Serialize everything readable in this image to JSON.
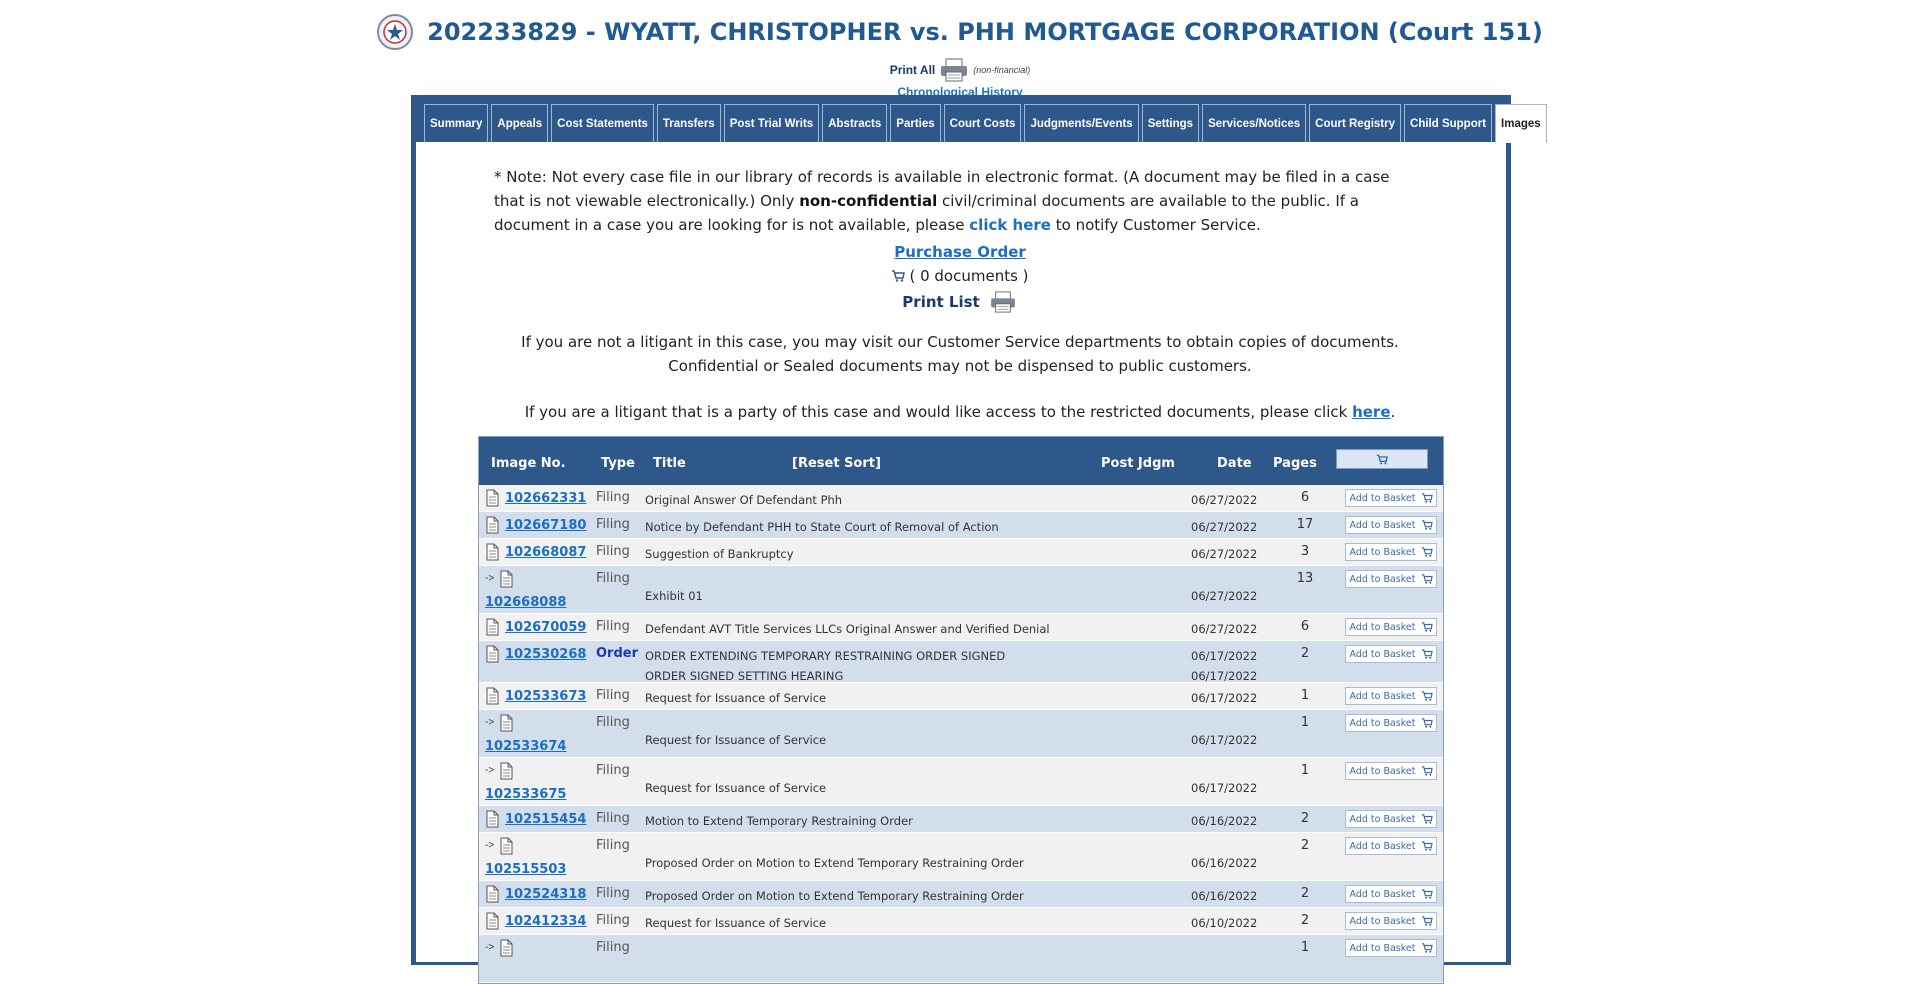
{
  "header": {
    "case_title": "202233829 - WYATT, CHRISTOPHER vs. PHH MORTGAGE CORPORATION (Court 151)",
    "print_all": "Print All",
    "non_financial": "(non-financial)",
    "chronological_history": "Chronological History"
  },
  "tabs": [
    {
      "label": "Summary"
    },
    {
      "label": "Appeals"
    },
    {
      "label": "Cost Statements"
    },
    {
      "label": "Transfers"
    },
    {
      "label": "Post Trial Writs"
    },
    {
      "label": "Abstracts"
    },
    {
      "label": "Parties"
    },
    {
      "label": "Court Costs"
    },
    {
      "label": "Judgments/Events"
    },
    {
      "label": "Settings"
    },
    {
      "label": "Services/Notices"
    },
    {
      "label": "Court Registry"
    },
    {
      "label": "Child Support"
    },
    {
      "label": "Images"
    }
  ],
  "notice": {
    "part1": "* Note: Not every case file in our library of records is available in electronic format. (A document may be filed in a case that is not viewable electronically.) Only ",
    "bold": "non-confidential",
    "part2": " civil/criminal documents are available to the public. If a document in a case you are looking for is not available, please ",
    "link": "click here",
    "part3": " to notify Customer Service."
  },
  "purchase_order": "Purchase Order",
  "documents_count": "( 0 documents )",
  "print_list": "Print List",
  "info_non_litigant": "If you are not a litigant in this case, you may visit our Customer Service departments to obtain copies of documents. Confidential or Sealed documents may not be dispensed to public customers.",
  "info_litigant": "If you are a litigant that is a party of this case and would like access to the restricted documents, please click ",
  "info_litigant_link": "here",
  "info_litigant_end": ".",
  "grid": {
    "headers": {
      "image_no": "Image No.",
      "type": "Type",
      "title": "Title",
      "reset_sort": "[Reset Sort]",
      "post_jdgm": "Post Jdgm",
      "date": "Date",
      "pages": "Pages",
      "add_entire_case": "Add Entire Case"
    },
    "add_to_basket": "Add to Basket",
    "rows": [
      {
        "image_no": "102662331",
        "type": "Filing",
        "title": "Original Answer Of Defendant Phh",
        "title2": "",
        "date": "06/27/2022",
        "date2": "",
        "pages": "6",
        "child": false
      },
      {
        "image_no": "102667180",
        "type": "Filing",
        "title": "Notice by Defendant PHH to State Court of Removal of Action",
        "title2": "",
        "date": "06/27/2022",
        "date2": "",
        "pages": "17",
        "child": false
      },
      {
        "image_no": "102668087",
        "type": "Filing",
        "title": "Suggestion of Bankruptcy",
        "title2": "",
        "date": "06/27/2022",
        "date2": "",
        "pages": "3",
        "child": false
      },
      {
        "image_no": "102668088",
        "type": "Filing",
        "title": "Exhibit 01",
        "title2": "",
        "date": "06/27/2022",
        "date2": "",
        "pages": "13",
        "child": true
      },
      {
        "image_no": "102670059",
        "type": "Filing",
        "title": "Defendant AVT Title Services LLCs Original Answer and Verified Denial",
        "title2": "",
        "date": "06/27/2022",
        "date2": "",
        "pages": "6",
        "child": false
      },
      {
        "image_no": "102530268",
        "type": "Order",
        "title": "ORDER EXTENDING TEMPORARY RESTRAINING ORDER SIGNED",
        "title2": "ORDER SIGNED SETTING HEARING",
        "date": "06/17/2022",
        "date2": "06/17/2022",
        "pages": "2",
        "child": false
      },
      {
        "image_no": "102533673",
        "type": "Filing",
        "title": "Request for Issuance of Service",
        "title2": "",
        "date": "06/17/2022",
        "date2": "",
        "pages": "1",
        "child": false
      },
      {
        "image_no": "102533674",
        "type": "Filing",
        "title": "Request for Issuance of Service",
        "title2": "",
        "date": "06/17/2022",
        "date2": "",
        "pages": "1",
        "child": true
      },
      {
        "image_no": "102533675",
        "type": "Filing",
        "title": "Request for Issuance of Service",
        "title2": "",
        "date": "06/17/2022",
        "date2": "",
        "pages": "1",
        "child": true
      },
      {
        "image_no": "102515454",
        "type": "Filing",
        "title": "Motion to Extend Temporary Restraining Order",
        "title2": "",
        "date": "06/16/2022",
        "date2": "",
        "pages": "2",
        "child": false
      },
      {
        "image_no": "102515503",
        "type": "Filing",
        "title": "Proposed Order on Motion to Extend Temporary Restraining Order",
        "title2": "",
        "date": "06/16/2022",
        "date2": "",
        "pages": "2",
        "child": true
      },
      {
        "image_no": "102524318",
        "type": "Filing",
        "title": "Proposed Order on Motion to Extend Temporary Restraining Order",
        "title2": "",
        "date": "06/16/2022",
        "date2": "",
        "pages": "2",
        "child": false
      },
      {
        "image_no": "102412334",
        "type": "Filing",
        "title": "Request for Issuance of Service",
        "title2": "",
        "date": "06/10/2022",
        "date2": "",
        "pages": "2",
        "child": false
      },
      {
        "image_no": "",
        "type": "Filing",
        "title": "",
        "title2": "",
        "date": "",
        "date2": "",
        "pages": "1",
        "child": true
      }
    ]
  }
}
